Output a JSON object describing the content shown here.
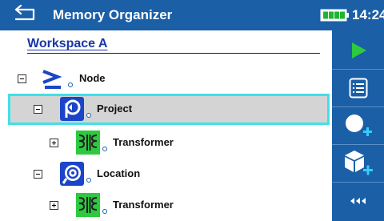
{
  "header": {
    "title": "Memory Organizer",
    "time": "14:24",
    "back_icon": "back-arrow-icon",
    "battery_icon": "battery-icon"
  },
  "workspace": {
    "title": "Workspace A"
  },
  "tree": [
    {
      "label": "Node",
      "icon": "node-icon",
      "expander": "collapse",
      "selected": false
    },
    {
      "label": "Project",
      "icon": "project-icon",
      "expander": "collapse",
      "selected": true
    },
    {
      "label": "Transformer",
      "icon": "transformer-icon",
      "expander": "expand",
      "selected": false
    },
    {
      "label": "Location",
      "icon": "location-icon",
      "expander": "collapse",
      "selected": false
    },
    {
      "label": "Transformer",
      "icon": "transformer-icon",
      "expander": "expand",
      "selected": false
    }
  ],
  "sidebar": {
    "buttons": [
      "play-icon",
      "list-icon",
      "add-measurement-icon",
      "add-structure-icon",
      "more-icon"
    ]
  },
  "colors": {
    "header": "#1b5fa7",
    "selection_outline": "#40e0e8",
    "selection_bg": "#d4d4d4",
    "workspace_text": "#1836a8",
    "play": "#2ec940",
    "add": "#33ccff"
  }
}
